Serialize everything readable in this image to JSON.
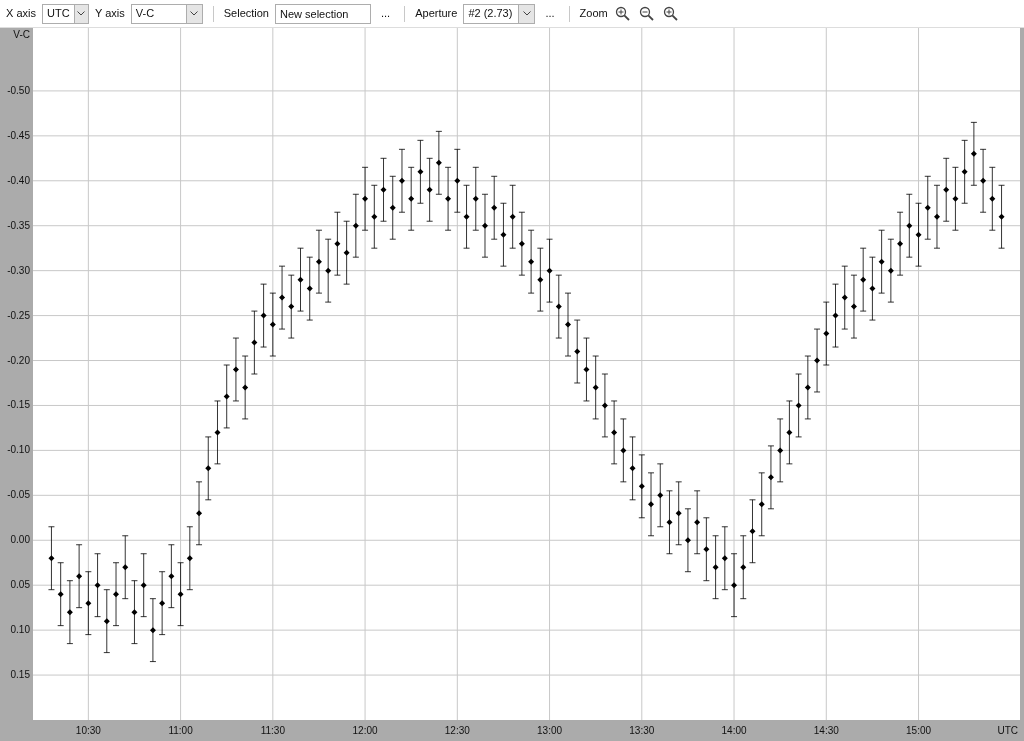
{
  "toolbar": {
    "x_axis": {
      "label": "X axis",
      "value": "UTC"
    },
    "y_axis": {
      "label": "Y axis",
      "value": "V-C"
    },
    "selection": {
      "label": "Selection",
      "value": "New selection",
      "more": "..."
    },
    "aperture": {
      "label": "Aperture",
      "value": "#2 (2.73)",
      "more": "..."
    },
    "zoom": {
      "label": "Zoom"
    }
  },
  "plot": {
    "chart_data": {
      "type": "scatter",
      "grid": true,
      "xlabel": "UTC",
      "ylabel": "V-C",
      "xlim": [
        10.2,
        15.55
      ],
      "ylim": [
        0.2,
        -0.57
      ],
      "xticks": [
        {
          "value": 10.5,
          "label": "10:30"
        },
        {
          "value": 11,
          "label": "11:00"
        },
        {
          "value": 11.5,
          "label": "11:30"
        },
        {
          "value": 12,
          "label": "12:00"
        },
        {
          "value": 12.5,
          "label": "12:30"
        },
        {
          "value": 13,
          "label": "13:00"
        },
        {
          "value": 13.5,
          "label": "13:30"
        },
        {
          "value": 14,
          "label": "14:00"
        },
        {
          "value": 14.5,
          "label": "14:30"
        },
        {
          "value": 15,
          "label": "15:00"
        }
      ],
      "yticks": [
        {
          "value": -0.5,
          "label": "-0.50"
        },
        {
          "value": -0.45,
          "label": "-0.45"
        },
        {
          "value": -0.4,
          "label": "-0.40"
        },
        {
          "value": -0.35,
          "label": "-0.35"
        },
        {
          "value": -0.3,
          "label": "-0.30"
        },
        {
          "value": -0.25,
          "label": "-0.25"
        },
        {
          "value": -0.2,
          "label": "-0.20"
        },
        {
          "value": -0.15,
          "label": "-0.15"
        },
        {
          "value": -0.1,
          "label": "-0.10"
        },
        {
          "value": -0.05,
          "label": "-0.05"
        },
        {
          "value": 0,
          "label": "0.00"
        },
        {
          "value": 0.05,
          "label": "0.05"
        },
        {
          "value": 0.1,
          "label": "0.10"
        },
        {
          "value": 0.15,
          "label": "0.15"
        }
      ],
      "x": [
        10.3,
        10.35,
        10.4,
        10.45,
        10.5,
        10.55,
        10.6,
        10.65,
        10.7,
        10.75,
        10.8,
        10.85,
        10.9,
        10.95,
        11,
        11.05,
        11.1,
        11.15,
        11.2,
        11.25,
        11.3,
        11.35,
        11.4,
        11.45,
        11.5,
        11.55,
        11.6,
        11.65,
        11.7,
        11.75,
        11.8,
        11.85,
        11.9,
        11.95,
        12,
        12.05,
        12.1,
        12.15,
        12.2,
        12.25,
        12.3,
        12.35,
        12.4,
        12.45,
        12.5,
        12.55,
        12.6,
        12.65,
        12.7,
        12.75,
        12.8,
        12.85,
        12.9,
        12.95,
        13,
        13.05,
        13.1,
        13.15,
        13.2,
        13.25,
        13.3,
        13.35,
        13.4,
        13.45,
        13.5,
        13.55,
        13.6,
        13.65,
        13.7,
        13.75,
        13.8,
        13.85,
        13.9,
        13.95,
        14,
        14.05,
        14.1,
        14.15,
        14.2,
        14.25,
        14.3,
        14.35,
        14.4,
        14.45,
        14.5,
        14.55,
        14.6,
        14.65,
        14.7,
        14.75,
        14.8,
        14.85,
        14.9,
        14.95,
        15,
        15.05,
        15.1,
        15.15,
        15.2,
        15.25,
        15.3,
        15.35,
        15.4,
        15.45
      ],
      "series": [
        {
          "color": "#000000",
          "errors": [
            0.035,
            0.035,
            0.035,
            0.035,
            0.035,
            0.035,
            0.035,
            0.035,
            0.035,
            0.035,
            0.035,
            0.035,
            0.035,
            0.035,
            0.035,
            0.035,
            0.035,
            0.035,
            0.035,
            0.035,
            0.035,
            0.035,
            0.035,
            0.035,
            0.035,
            0.035,
            0.035,
            0.035,
            0.035,
            0.035,
            0.035,
            0.035,
            0.035,
            0.035,
            0.035,
            0.035,
            0.035,
            0.035,
            0.035,
            0.035,
            0.035,
            0.035,
            0.035,
            0.035,
            0.035,
            0.035,
            0.035,
            0.035,
            0.035,
            0.035,
            0.035,
            0.035,
            0.035,
            0.035,
            0.035,
            0.035,
            0.035,
            0.035,
            0.035,
            0.035,
            0.035,
            0.035,
            0.035,
            0.035,
            0.035,
            0.035,
            0.035,
            0.035,
            0.035,
            0.035,
            0.035,
            0.035,
            0.035,
            0.035,
            0.035,
            0.035,
            0.035,
            0.035,
            0.035,
            0.035,
            0.035,
            0.035,
            0.035,
            0.035,
            0.035,
            0.035,
            0.035,
            0.035,
            0.035,
            0.035,
            0.035,
            0.035,
            0.035,
            0.035,
            0.035,
            0.035,
            0.035,
            0.035,
            0.035,
            0.035,
            0.035,
            0.035,
            0.035,
            0.035
          ],
          "values": [
            0.02,
            0.06,
            0.08,
            0.04,
            0.07,
            0.05,
            0.09,
            0.06,
            0.03,
            0.08,
            0.05,
            0.1,
            0.07,
            0.04,
            0.06,
            0.02,
            -0.03,
            -0.08,
            -0.12,
            -0.16,
            -0.19,
            -0.17,
            -0.22,
            -0.25,
            -0.24,
            -0.27,
            -0.26,
            -0.29,
            -0.28,
            -0.31,
            -0.3,
            -0.33,
            -0.32,
            -0.35,
            -0.38,
            -0.36,
            -0.39,
            -0.37,
            -0.4,
            -0.38,
            -0.41,
            -0.39,
            -0.42,
            -0.38,
            -0.4,
            -0.36,
            -0.38,
            -0.35,
            -0.37,
            -0.34,
            -0.36,
            -0.33,
            -0.31,
            -0.29,
            -0.3,
            -0.26,
            -0.24,
            -0.21,
            -0.19,
            -0.17,
            -0.15,
            -0.12,
            -0.1,
            -0.08,
            -0.06,
            -0.04,
            -0.05,
            -0.02,
            -0.03,
            0,
            -0.02,
            0.01,
            0.03,
            0.02,
            0.05,
            0.03,
            -0.01,
            -0.04,
            -0.07,
            -0.1,
            -0.12,
            -0.15,
            -0.17,
            -0.2,
            -0.23,
            -0.25,
            -0.27,
            -0.26,
            -0.29,
            -0.28,
            -0.31,
            -0.3,
            -0.33,
            -0.35,
            -0.34,
            -0.37,
            -0.36,
            -0.39,
            -0.38,
            -0.41,
            -0.43,
            -0.4,
            -0.38,
            -0.36
          ]
        }
      ]
    }
  }
}
